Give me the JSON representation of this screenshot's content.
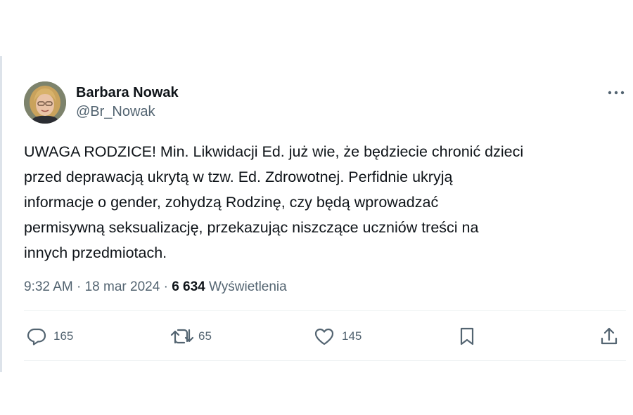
{
  "author": {
    "display_name": "Barbara Nowak",
    "handle": "@Br_Nowak"
  },
  "tweet": {
    "text": "UWAGA RODZICE! Min. Likwidacji Ed. już wie, że będziecie chronić dzieci\nprzed deprawacją ukrytą w tzw. Ed. Zdrowotnej. Perfidnie ukryją\ninformacje o gender, zohydzą Rodzinę, czy będą wprowadzać\npermisywną seksualizację, przekazując niszczące uczniów treści na\ninnych przedmiotach.",
    "time": "9:32 AM",
    "date": "18 mar 2024",
    "separator": " · ",
    "views_count": "6 634",
    "views_label": "Wyświetlenia"
  },
  "actions": {
    "replies": "165",
    "reposts": "65",
    "likes": "145"
  },
  "icons": {
    "more": "more-options-icon",
    "reply": "reply-icon",
    "repost": "repost-icon",
    "like": "like-icon",
    "bookmark": "bookmark-icon",
    "share": "share-icon"
  },
  "colors": {
    "text_primary": "#0f1419",
    "text_secondary": "#536471",
    "divider": "#eff3f4"
  }
}
